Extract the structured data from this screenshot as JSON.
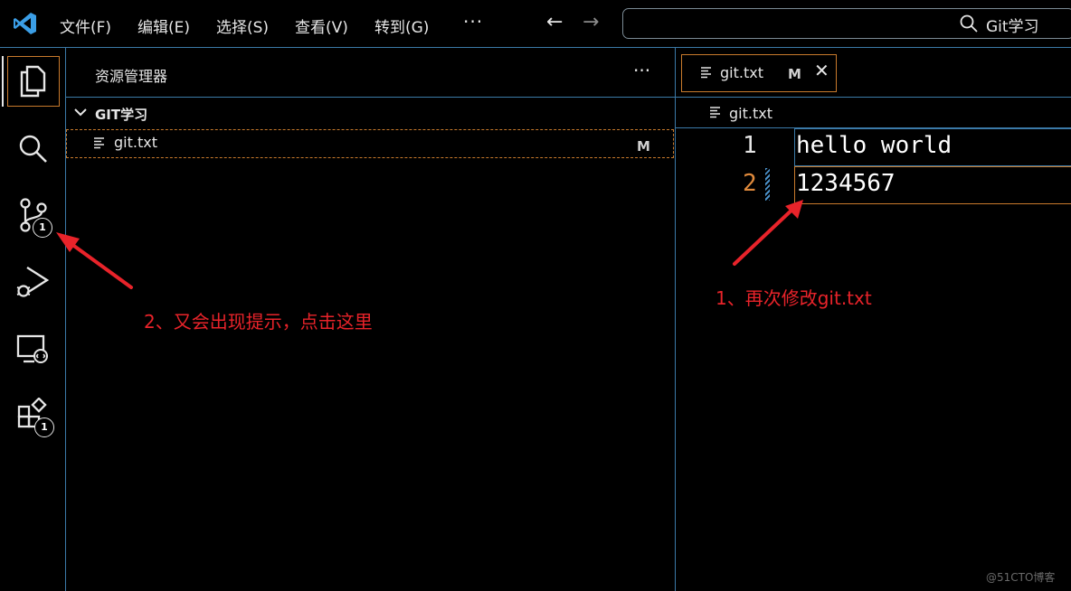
{
  "titlebar": {
    "menus": [
      "文件(F)",
      "编辑(E)",
      "选择(S)",
      "查看(V)",
      "转到(G)"
    ],
    "more_label": "···",
    "back_label": "←",
    "forward_label": "→",
    "search_text": "Git学习"
  },
  "activitybar": {
    "items": [
      "explorer-icon",
      "search-icon",
      "source-control-icon",
      "run-debug-icon",
      "remote-explorer-icon",
      "extensions-icon"
    ],
    "source_control_badge": "1",
    "extensions_badge": "1"
  },
  "sidebar": {
    "title": "资源管理器",
    "more_label": "···",
    "folder": "GIT学习",
    "files": [
      {
        "name": "git.txt",
        "status": "M"
      }
    ]
  },
  "editor": {
    "tab": {
      "label": "git.txt",
      "status": "M",
      "close_label": "✕"
    },
    "breadcrumb": "git.txt",
    "lines": [
      {
        "number": "1",
        "text": "hello world"
      },
      {
        "number": "2",
        "text": "1234567"
      }
    ]
  },
  "annotations": {
    "step1": "1、再次修改git.txt",
    "step2": "2、又会出现提示，点击这里"
  },
  "watermark": "@51CTO博客",
  "colors": {
    "accent_orange": "#c87a2c",
    "divider_blue": "#3b7aa8",
    "annotation_red": "#e8232a",
    "vscode_blue": "#3b9ee6"
  }
}
